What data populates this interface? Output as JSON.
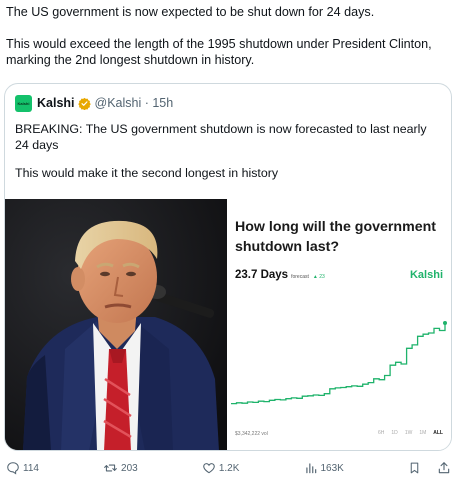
{
  "tweet": {
    "paragraph1": "The US government is now expected to be shut down for 24 days.",
    "paragraph2": "This would exceed the length of the 1995 shutdown under President Clinton, marking the 2nd longest shutdown in history."
  },
  "quote": {
    "avatar_text": "Kalshi",
    "name": "Kalshi",
    "handle_time": "@Kalshi · 15h",
    "verified_color": "#e8a800",
    "paragraph1": "BREAKING: The US government shutdown is now forecasted to last nearly 24 days",
    "paragraph2": "This would make it the second longest in history"
  },
  "market_card": {
    "title": "How long will the government shutdown last?",
    "value": "23.7 Days",
    "forecast_label": "forecast",
    "delta": "▲ 23",
    "brand": "Kalshi",
    "brand_color": "#1fb36b",
    "volume": "$3,342,222 vol",
    "ranges": [
      "6H",
      "1D",
      "1W",
      "1M",
      "ALL"
    ],
    "active_range": "ALL"
  },
  "chart_data": {
    "type": "line",
    "title": "How long will the government shutdown last?",
    "xlabel": "",
    "ylabel": "",
    "grid": false,
    "color": "#1fb36b",
    "ylim": [
      0,
      30
    ],
    "x": [
      0,
      1,
      2,
      3,
      4,
      5,
      6,
      7,
      8,
      9,
      10,
      11,
      12,
      13,
      14,
      15,
      16,
      17,
      18,
      19,
      20,
      21,
      22,
      23,
      24,
      25,
      26,
      27,
      28,
      29,
      30,
      31,
      32,
      33,
      34,
      35,
      36,
      37,
      38,
      39
    ],
    "values": [
      4.2,
      4.4,
      4.3,
      4.6,
      4.5,
      4.8,
      4.7,
      5.0,
      5.2,
      5.1,
      5.4,
      5.6,
      5.5,
      6.0,
      6.1,
      6.3,
      6.2,
      6.6,
      7.8,
      8.0,
      8.1,
      8.3,
      8.5,
      8.4,
      8.9,
      9.3,
      10.2,
      10.0,
      11.0,
      13.5,
      14.2,
      13.8,
      17.6,
      18.4,
      20.5,
      21.0,
      21.3,
      22.4,
      21.9,
      23.7
    ]
  },
  "actions": {
    "replies": "114",
    "reposts": "203",
    "likes": "1.2K",
    "views": "163K"
  }
}
